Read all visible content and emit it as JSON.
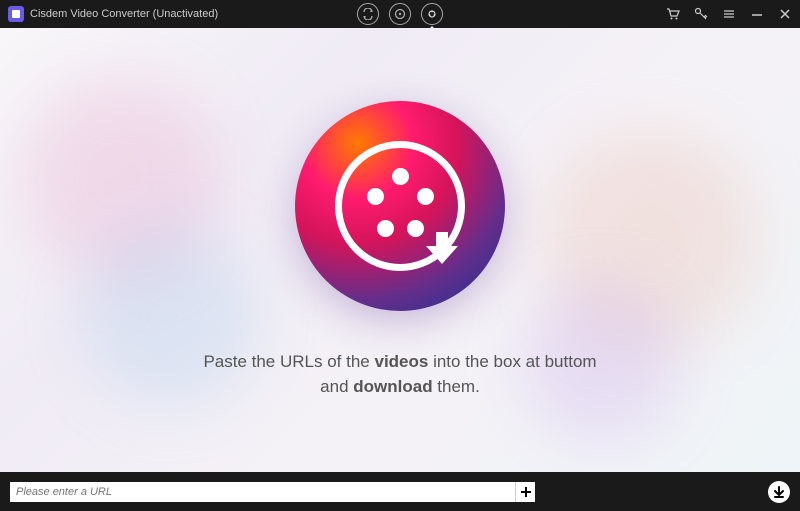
{
  "titlebar": {
    "title": "Cisdem Video Converter (Unactivated)"
  },
  "modes": {
    "convert": "convert",
    "disc": "disc",
    "download": "download"
  },
  "toolbar": {
    "cart": "cart",
    "key": "key",
    "menu": "menu",
    "minimize": "minimize",
    "close": "close"
  },
  "instruction": {
    "prefix": "Paste the URLs of the ",
    "bold1": "videos",
    "middle": " into the box at buttom",
    "line2_prefix": "and ",
    "bold2": "download",
    "line2_suffix": " them."
  },
  "urlbar": {
    "placeholder": "Please enter a URL"
  }
}
